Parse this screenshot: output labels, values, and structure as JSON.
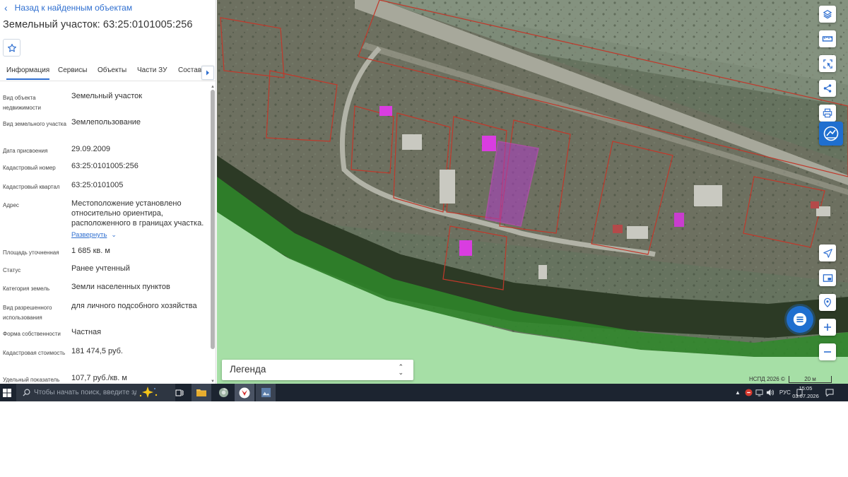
{
  "panel": {
    "back_label": "Назад к найденным объектам",
    "title": "Земельный участок: 63:25:0101005:256",
    "tabs": [
      {
        "label": "Информация",
        "active": true
      },
      {
        "label": "Сервисы",
        "active": false
      },
      {
        "label": "Объекты",
        "active": false
      },
      {
        "label": "Части ЗУ",
        "active": false
      },
      {
        "label": "Состав",
        "active": false
      }
    ],
    "fields": [
      {
        "label": "Вид объекта недвижимости",
        "value": "Земельный участок"
      },
      {
        "label": "Вид земельного участка",
        "value": "Землепользование"
      },
      {
        "label": "Дата присвоения",
        "value": "29.09.2009"
      },
      {
        "label": "Кадастровый номер",
        "value": "63:25:0101005:256"
      },
      {
        "label": "Кадастровый квартал",
        "value": "63:25:0101005"
      },
      {
        "label": "Адрес",
        "value": "Местоположение установлено относительно ориентира, расположенного в границах участка.",
        "link": "Развернуть"
      },
      {
        "label": "Площадь уточненная",
        "value": "1 685 кв. м"
      },
      {
        "label": "Статус",
        "value": "Ранее учтенный"
      },
      {
        "label": "Категория земель",
        "value": "Земли населенных пунктов"
      },
      {
        "label": "Вид разрешенного использования",
        "value": "для личного подсобного хозяйства"
      },
      {
        "label": "Форма собственности",
        "value": "Частная"
      },
      {
        "label": "Кадастровая стоимость",
        "value": "181 474,5 руб."
      },
      {
        "label": "Удельный показатель",
        "value": "107,7 руб./кв. м"
      }
    ]
  },
  "map": {
    "legend_label": "Легенда",
    "credit": "НСПД 2026 ©",
    "scale_label": "20 м",
    "controls_top": [
      "layers-icon",
      "ruler-icon",
      "select-area-icon",
      "share-icon",
      "print-icon",
      "compare-icon"
    ],
    "controls_bottom": [
      "locate-icon",
      "minimap-icon",
      "pin-icon",
      "zoom-in-icon",
      "zoom-out-icon"
    ]
  },
  "taskbar": {
    "search_placeholder": "Чтобы начать поиск, введите зде",
    "language": "РУС",
    "time": "15:05",
    "date": "03.07.2026"
  }
}
